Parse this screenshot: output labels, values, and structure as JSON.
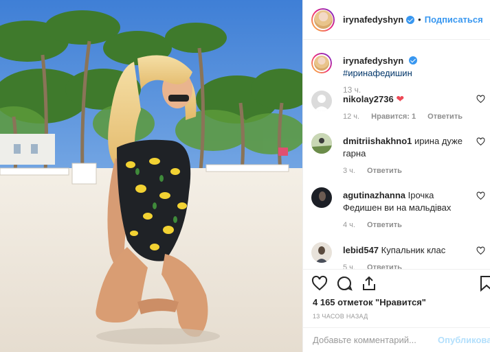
{
  "header": {
    "username": "irynafedyshyn",
    "separator": "•",
    "follow_label": "Подписаться"
  },
  "caption": {
    "username": "irynafedyshyn",
    "text": "#иринафедишин",
    "time": "13 ч."
  },
  "comments": [
    {
      "username": "nikolay2736",
      "text": "❤",
      "time": "12 ч.",
      "likes": "Нравится: 1",
      "reply": "Ответить"
    },
    {
      "username": "dmitriishakhno1",
      "text": "ирина дуже гарна",
      "time": "3 ч.",
      "reply": "Ответить"
    },
    {
      "username": "agutinazhanna",
      "text": "Ірочка Федишен ви на мальдівах",
      "time": "4 ч.",
      "reply": "Ответить"
    },
    {
      "username": "lebid547",
      "text": "Купальник клас",
      "time": "5 ч.",
      "reply": "Ответить"
    }
  ],
  "likes_count": "4 165 отметок \"Нравится\"",
  "posted_ago": "13 ЧАСОВ НАЗАД",
  "comment_input": {
    "placeholder": "Добавьте комментарий...",
    "publish_label": "Опубликовать"
  },
  "icons": [
    "heart-icon",
    "comment-icon",
    "share-icon",
    "bookmark-icon",
    "verified-badge-icon"
  ],
  "colors": {
    "accent": "#3897f0",
    "heart": "#ed4956",
    "muted": "#999999",
    "border": "#efefef"
  }
}
